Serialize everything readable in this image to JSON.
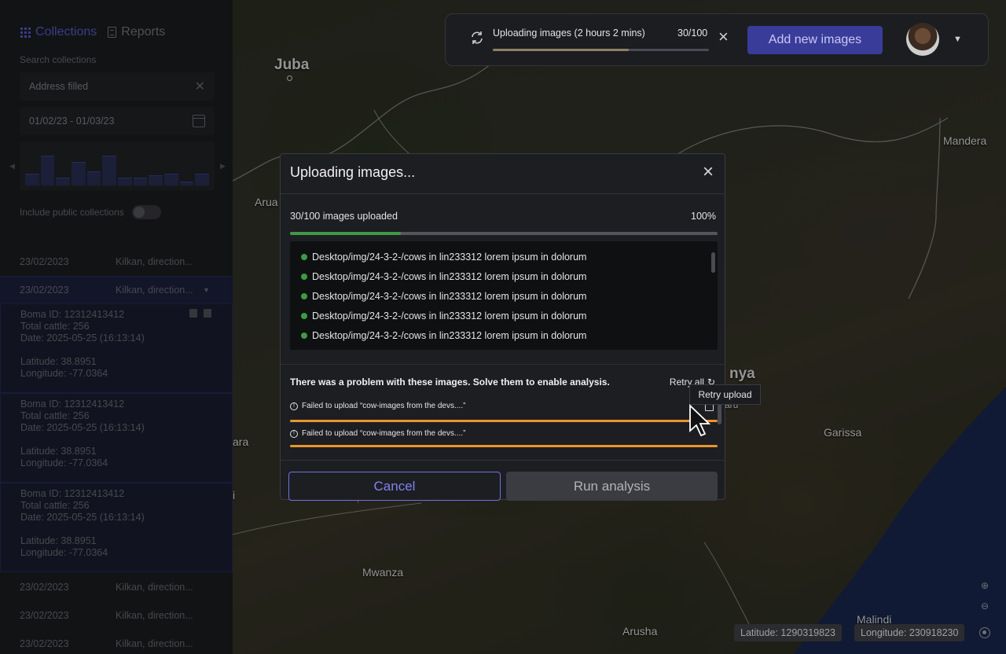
{
  "sidebar": {
    "tabs": [
      {
        "label": "Collections",
        "icon": "grid-icon"
      },
      {
        "label": "Reports",
        "icon": "document-icon"
      }
    ],
    "search_label": "Search collections",
    "search_value": "Address filled",
    "date_range": "01/02/23 - 01/03/23",
    "histogram_values": [
      0.3,
      0.75,
      0.2,
      0.6,
      0.35,
      0.75,
      0.2,
      0.2,
      0.25,
      0.3,
      0.1,
      0.3
    ],
    "public_toggle_label": "Include public collections",
    "public_toggle_on": false,
    "rows": [
      {
        "date": "23/02/2023",
        "desc": "Kilkan, direction..."
      },
      {
        "date": "23/02/2023",
        "desc": "Kilkan, direction..."
      }
    ],
    "cards": [
      {
        "boma": "Boma ID: 12312413412",
        "cattle": "Total cattle: 256",
        "date": "Date: 2025-05-25 (16:13:14)",
        "lat": "Latitude: 38.8951",
        "lon": "Longitude: -77.0364"
      },
      {
        "boma": "Boma ID: 12312413412",
        "cattle": "Total cattle: 256",
        "date": "Date: 2025-05-25 (16:13:14)",
        "lat": "Latitude: 38.8951",
        "lon": "Longitude: -77.0364"
      },
      {
        "boma": "Boma ID: 12312413412",
        "cattle": "Total cattle: 256",
        "date": "Date: 2025-05-25 (16:13:14)",
        "lat": "Latitude: 38.8951",
        "lon": "Longitude: -77.0364"
      }
    ],
    "bottom_rows": [
      {
        "date": "23/02/2023",
        "desc": "Kilkan, direction..."
      },
      {
        "date": "23/02/2023",
        "desc": "Kilkan, direction..."
      },
      {
        "date": "23/02/2023",
        "desc": "Kilkan, direction..."
      }
    ]
  },
  "topbar": {
    "upload_title": "Uploading images (2 hours 2 mins)",
    "upload_count": "30/100",
    "upload_progress": 0.63,
    "add_button": "Add new images"
  },
  "modal": {
    "title": "Uploading images...",
    "count_label": "30/100 images uploaded",
    "percent_label": "100%",
    "progress": 0.26,
    "files": [
      "Desktop/img/24-3-2-/cows in lin233312 lorem ipsum in dolorum",
      "Desktop/img/24-3-2-/cows in lin233312 lorem ipsum in dolorum",
      "Desktop/img/24-3-2-/cows in lin233312 lorem ipsum in dolorum",
      "Desktop/img/24-3-2-/cows in lin233312 lorem ipsum in dolorum",
      "Desktop/img/24-3-2-/cows in lin233312 lorem ipsum in dolorum"
    ],
    "problem_title": "There was a problem with these images. Solve them to enable analysis.",
    "retry_all": "Retry all",
    "errors": [
      "Failed to upload “cow-images from the devs....”",
      "Failed to upload “cow-images from the devs....”"
    ],
    "tooltip": "Retry upload",
    "cancel_button": "Cancel",
    "run_button": "Run analysis"
  },
  "map": {
    "cities": {
      "juba": "Juba",
      "arua": "Arua",
      "mandera": "Mandera",
      "kenya": "nya",
      "garissa": "Garissa",
      "mwanza": "Mwanza",
      "malindi": "Malindi",
      "arusha": "Arusha",
      "aru": "aru",
      "nairobi": "ara",
      "i": "i"
    },
    "latitude": "Latitude: 1290319823",
    "longitude": "Longitude: 230918230"
  },
  "colors": {
    "accent": "#5b5fd6",
    "success": "#3e9a45",
    "warning": "#e9952f"
  }
}
